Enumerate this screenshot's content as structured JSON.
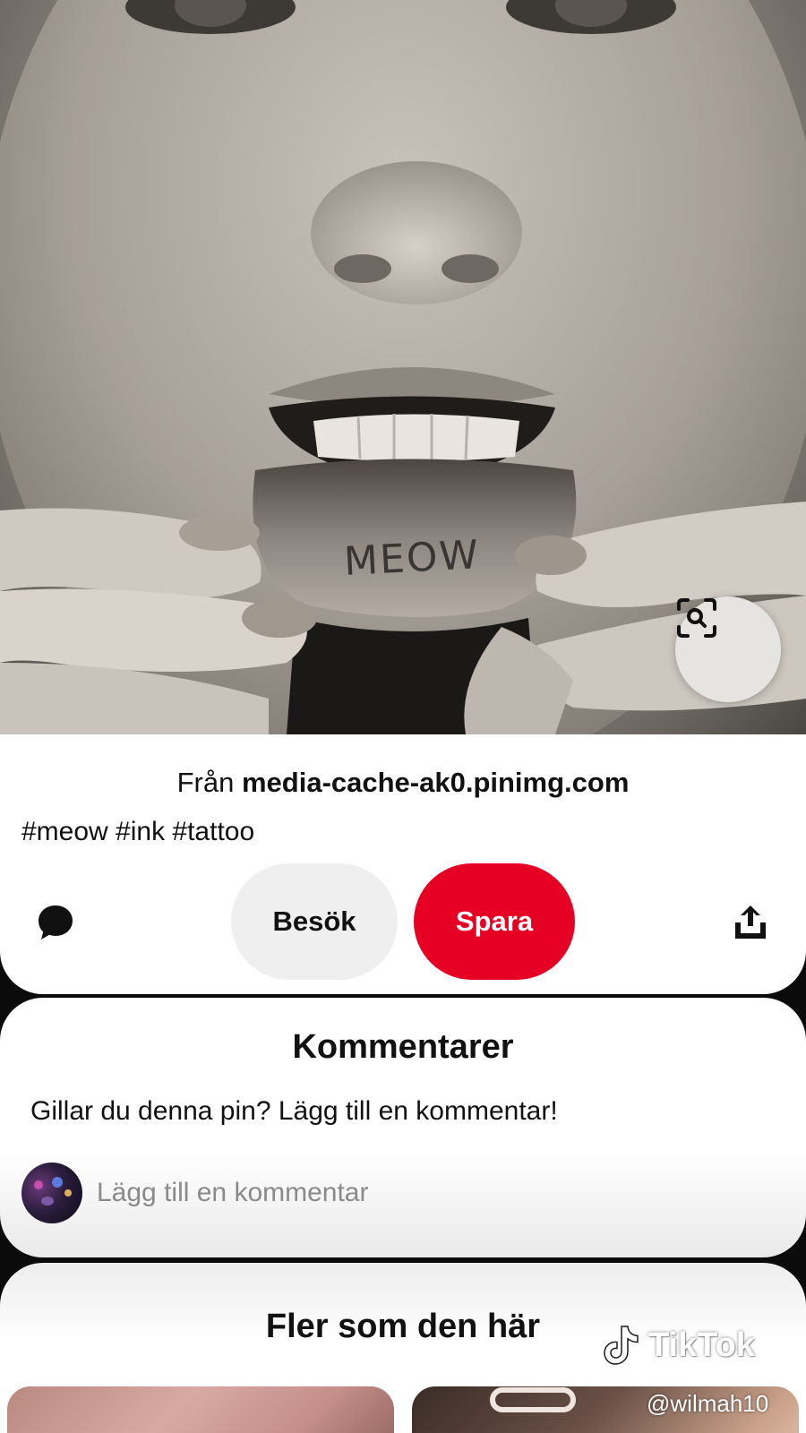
{
  "pin": {
    "image_alt": "Close-up photo of a person pulling down their lower lip to show a tattoo",
    "tattoo_text": "MEOW",
    "source_prefix": "Från",
    "source_domain": "media-cache-ak0.pinimg.com",
    "tags": "#meow #ink #tattoo"
  },
  "actions": {
    "visit_label": "Besök",
    "save_label": "Spara",
    "comment_icon": "comment-bubble-icon",
    "share_icon": "share-upload-icon",
    "lens_icon": "visual-search-icon"
  },
  "comments": {
    "title": "Kommentarer",
    "prompt": "Gillar du denna pin? Lägg till en kommentar!",
    "input_placeholder": "Lägg till en kommentar"
  },
  "more": {
    "title": "Fler som den här"
  },
  "watermark": {
    "brand": "TikTok",
    "handle": "@wilmah10"
  },
  "colors": {
    "save_red": "#e60023",
    "visit_gray": "#efefef",
    "card_white": "#ffffff",
    "background": "#0b0b0b"
  }
}
